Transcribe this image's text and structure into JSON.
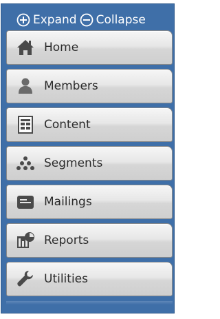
{
  "toolbar": {
    "expand_label": "Expand",
    "collapse_label": "Collapse"
  },
  "menu": {
    "items": [
      {
        "label": "Home",
        "icon": "home-icon"
      },
      {
        "label": "Members",
        "icon": "members-icon"
      },
      {
        "label": "Content",
        "icon": "content-icon"
      },
      {
        "label": "Segments",
        "icon": "segments-icon"
      },
      {
        "label": "Mailings",
        "icon": "mailings-icon"
      },
      {
        "label": "Reports",
        "icon": "reports-icon"
      },
      {
        "label": "Utilities",
        "icon": "utilities-icon"
      }
    ]
  },
  "colors": {
    "frame_blue": "#3f6fa8",
    "button_face": "#e0e0e0",
    "icon_gray": "#4a4a4a",
    "text": "#2b2b2b"
  }
}
